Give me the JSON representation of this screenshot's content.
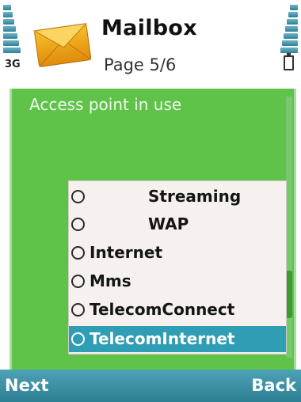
{
  "status": {
    "network": "3G"
  },
  "header": {
    "icon": "mailbox-envelope-icon",
    "title": "Mailbox",
    "page_indicator": "Page 5/6"
  },
  "setting": {
    "label": "Access point in use"
  },
  "access_points": [
    {
      "label": "Streaming",
      "selected": false
    },
    {
      "label": "WAP",
      "selected": false
    },
    {
      "label": "Internet",
      "selected": false
    },
    {
      "label": "Mms",
      "selected": false
    },
    {
      "label": "TelecomConnect",
      "selected": false
    },
    {
      "label": "TelecomInternet",
      "selected": true
    }
  ],
  "softkeys": {
    "left": "Next",
    "right": "Back"
  },
  "colors": {
    "panel": "#5fc34a",
    "highlight": "#2f9db4",
    "softbar": "#3a8fa5"
  }
}
